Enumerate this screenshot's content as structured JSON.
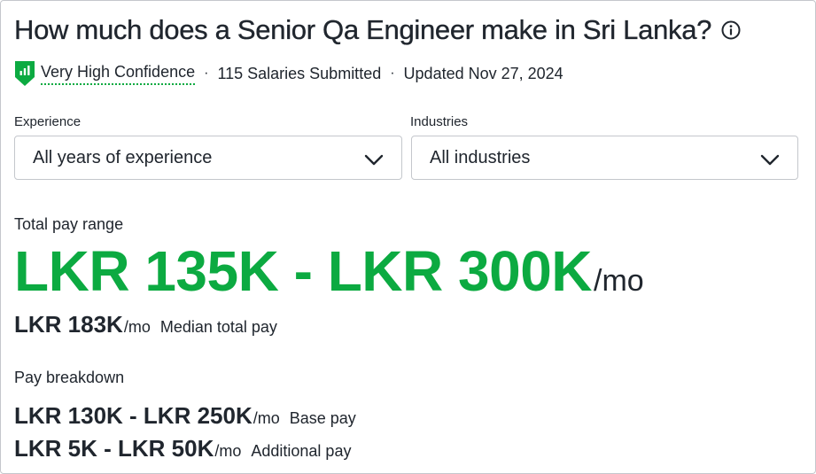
{
  "header": {
    "title": "How much does a Senior Qa Engineer make in Sri Lanka?",
    "info_icon": "info-icon"
  },
  "meta": {
    "confidence_icon": "shield-chart-icon",
    "confidence_label": "Very High Confidence",
    "separator": "·",
    "salaries_submitted": "115 Salaries Submitted",
    "updated": "Updated Nov 27, 2024"
  },
  "filters": {
    "experience": {
      "label": "Experience",
      "value": "All years of experience",
      "icon": "chevron-down-icon"
    },
    "industries": {
      "label": "Industries",
      "value": "All industries",
      "icon": "chevron-down-icon"
    }
  },
  "total_pay": {
    "label": "Total pay range",
    "range": "LKR 135K - LKR 300K",
    "unit": "/mo",
    "median_value": "LKR 183K",
    "median_unit": "/mo",
    "median_label": "Median total pay"
  },
  "breakdown": {
    "label": "Pay breakdown",
    "base_value": "LKR 130K - LKR 250K",
    "base_unit": "/mo",
    "base_label": "Base pay",
    "additional_value": "LKR 5K - LKR 50K",
    "additional_unit": "/mo",
    "additional_label": "Additional pay"
  },
  "colors": {
    "accent_green": "#0caa41",
    "text": "#20262e",
    "border": "#c4c7cc"
  }
}
